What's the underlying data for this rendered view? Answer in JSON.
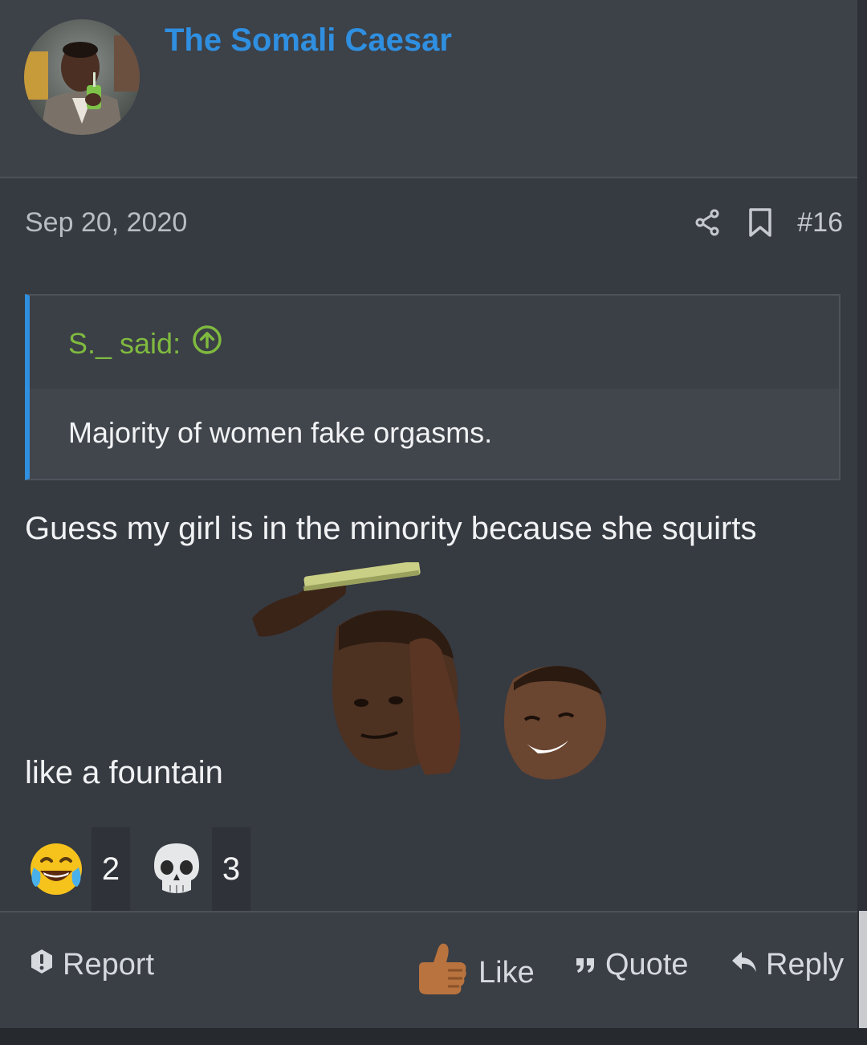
{
  "user": {
    "name": "The Somali Caesar"
  },
  "post": {
    "date": "Sep 20, 2020",
    "number": "#16",
    "quote": {
      "author": "S._ said:",
      "text": "Majority of women fake orgasms."
    },
    "message": {
      "line1": "Guess my girl is in the minority because she squirts",
      "line2": "like a fountain"
    }
  },
  "reactions": [
    {
      "icon": "tears-of-joy-emoji",
      "count": "2"
    },
    {
      "icon": "skull-emoji",
      "count": "3"
    }
  ],
  "actions": {
    "report": "Report",
    "like": "Like",
    "quote": "Quote",
    "reply": "Reply"
  },
  "colors": {
    "username": "#2f8fe0",
    "quote_author": "#7fba3f",
    "quote_border": "#2f8fe0"
  }
}
